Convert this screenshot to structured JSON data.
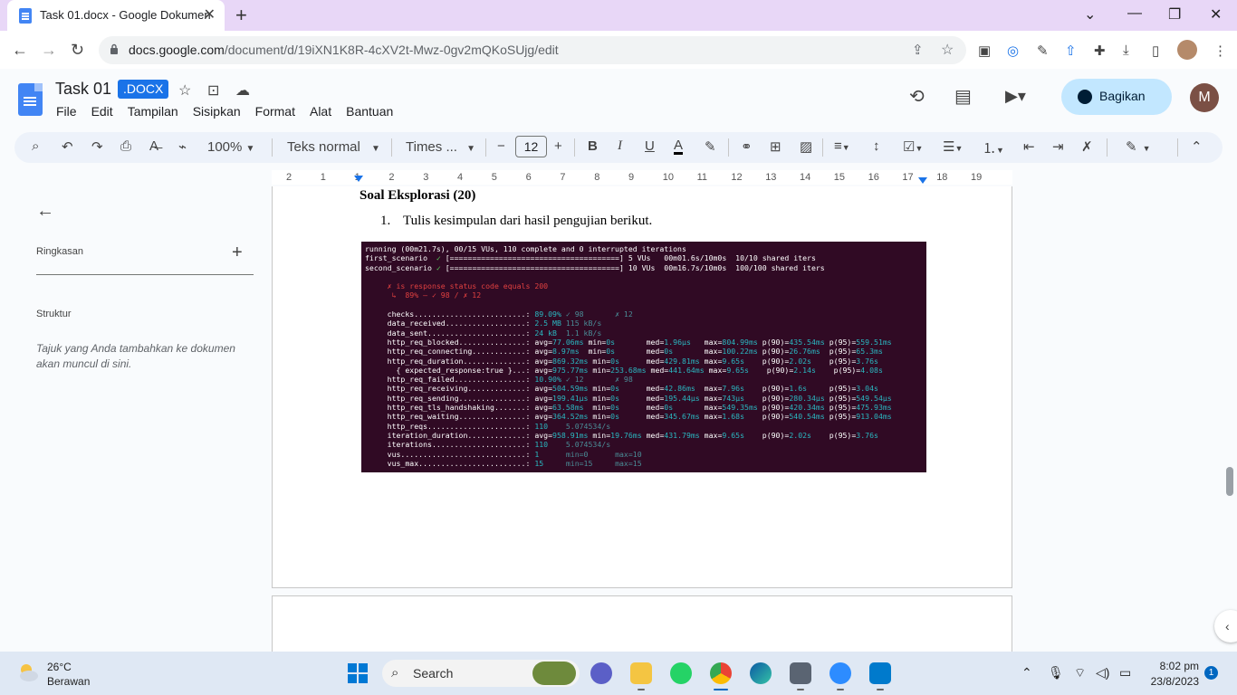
{
  "browser": {
    "tab_title": "Task 01.docx - Google Dokumen",
    "url_host": "docs.google.com",
    "url_path": "/document/d/19iXN1K8R-4cXV2t-Mwz-0gv2mQKoSUjg/edit"
  },
  "docs": {
    "title": "Task 01",
    "badge": ".DOCX",
    "menu": [
      "File",
      "Edit",
      "Tampilan",
      "Sisipkan",
      "Format",
      "Alat",
      "Bantuan"
    ],
    "share_label": "Bagikan",
    "avatar_letter": "M"
  },
  "toolbar": {
    "zoom": "100%",
    "style": "Teks normal",
    "font": "Times ...",
    "font_size": "12"
  },
  "ruler": [
    "2",
    "1",
    "1",
    "2",
    "3",
    "4",
    "5",
    "6",
    "7",
    "8",
    "9",
    "10",
    "11",
    "12",
    "13",
    "14",
    "15",
    "16",
    "17",
    "18",
    "19"
  ],
  "sidebar": {
    "summary_label": "Ringkasan",
    "structure_label": "Struktur",
    "hint": "Tajuk yang Anda tambahkan ke dokumen akan muncul di sini."
  },
  "document": {
    "heading": "Soal Eksplorasi (20)",
    "list_number": "1.",
    "list_text": "Tulis kesimpulan dari hasil pengujian berikut."
  },
  "terminal": {
    "lines": [
      [
        {
          "t": "running (00m21.7s), 00/15 VUs, 110 complete and 0 interrupted iterations",
          "c": ""
        }
      ],
      [
        {
          "t": "first_scenario  ",
          "c": ""
        },
        {
          "t": "✓",
          "c": "g"
        },
        {
          "t": " [======================================] 5 VUs   00m01.6s/10m0s  10/10 shared iters",
          "c": ""
        }
      ],
      [
        {
          "t": "second_scenario ",
          "c": ""
        },
        {
          "t": "✓",
          "c": "g"
        },
        {
          "t": " [======================================] 10 VUs  00m16.7s/10m0s  100/100 shared iters",
          "c": ""
        }
      ],
      [
        {
          "t": " ",
          "c": ""
        }
      ],
      [
        {
          "t": "     ✗ is response status code equals 200",
          "c": "r"
        }
      ],
      [
        {
          "t": "      ↳  89% — ✓ 98 / ✗ 12",
          "c": "r"
        }
      ],
      [
        {
          "t": " ",
          "c": ""
        }
      ],
      [
        {
          "t": "     checks.........................: ",
          "c": ""
        },
        {
          "t": "89.09% ",
          "c": "c"
        },
        {
          "t": "✓ 98       ",
          "c": "d"
        },
        {
          "t": "✗ 12",
          "c": "d"
        }
      ],
      [
        {
          "t": "     data_received..................: ",
          "c": ""
        },
        {
          "t": "2.5 MB ",
          "c": "c"
        },
        {
          "t": "115 kB/s",
          "c": "d"
        }
      ],
      [
        {
          "t": "     data_sent......................: ",
          "c": ""
        },
        {
          "t": "24 kB  ",
          "c": "c"
        },
        {
          "t": "1.1 kB/s",
          "c": "d"
        }
      ],
      [
        {
          "t": "     http_req_blocked...............: ",
          "c": ""
        },
        {
          "t": "avg=",
          "c": ""
        },
        {
          "t": "77.06ms ",
          "c": "c"
        },
        {
          "t": "min=",
          "c": ""
        },
        {
          "t": "0s       ",
          "c": "c"
        },
        {
          "t": "med=",
          "c": ""
        },
        {
          "t": "1.96µs   ",
          "c": "c"
        },
        {
          "t": "max=",
          "c": ""
        },
        {
          "t": "804.99ms ",
          "c": "c"
        },
        {
          "t": "p(90)=",
          "c": ""
        },
        {
          "t": "435.54ms ",
          "c": "c"
        },
        {
          "t": "p(95)=",
          "c": ""
        },
        {
          "t": "559.51ms",
          "c": "c"
        }
      ],
      [
        {
          "t": "     http_req_connecting............: ",
          "c": ""
        },
        {
          "t": "avg=",
          "c": ""
        },
        {
          "t": "8.97ms  ",
          "c": "c"
        },
        {
          "t": "min=",
          "c": ""
        },
        {
          "t": "0s       ",
          "c": "c"
        },
        {
          "t": "med=",
          "c": ""
        },
        {
          "t": "0s       ",
          "c": "c"
        },
        {
          "t": "max=",
          "c": ""
        },
        {
          "t": "100.22ms ",
          "c": "c"
        },
        {
          "t": "p(90)=",
          "c": ""
        },
        {
          "t": "26.76ms  ",
          "c": "c"
        },
        {
          "t": "p(95)=",
          "c": ""
        },
        {
          "t": "65.3ms",
          "c": "c"
        }
      ],
      [
        {
          "t": "     http_req_duration..............: ",
          "c": ""
        },
        {
          "t": "avg=",
          "c": ""
        },
        {
          "t": "869.32ms ",
          "c": "c"
        },
        {
          "t": "min=",
          "c": ""
        },
        {
          "t": "0s      ",
          "c": "c"
        },
        {
          "t": "med=",
          "c": ""
        },
        {
          "t": "429.81ms ",
          "c": "c"
        },
        {
          "t": "max=",
          "c": ""
        },
        {
          "t": "9.65s    ",
          "c": "c"
        },
        {
          "t": "p(90)=",
          "c": ""
        },
        {
          "t": "2.02s    ",
          "c": "c"
        },
        {
          "t": "p(95)=",
          "c": ""
        },
        {
          "t": "3.76s",
          "c": "c"
        }
      ],
      [
        {
          "t": "       { expected_response:true }...: ",
          "c": ""
        },
        {
          "t": "avg=",
          "c": ""
        },
        {
          "t": "975.77ms ",
          "c": "c"
        },
        {
          "t": "min=",
          "c": ""
        },
        {
          "t": "253.68ms ",
          "c": "c"
        },
        {
          "t": "med=",
          "c": ""
        },
        {
          "t": "441.64ms ",
          "c": "c"
        },
        {
          "t": "max=",
          "c": ""
        },
        {
          "t": "9.65s    ",
          "c": "c"
        },
        {
          "t": "p(90)=",
          "c": ""
        },
        {
          "t": "2.14s    ",
          "c": "c"
        },
        {
          "t": "p(95)=",
          "c": ""
        },
        {
          "t": "4.08s",
          "c": "c"
        }
      ],
      [
        {
          "t": "     http_req_failed................: ",
          "c": ""
        },
        {
          "t": "10.90% ",
          "c": "c"
        },
        {
          "t": "✓ 12       ",
          "c": "d"
        },
        {
          "t": "✗ 98",
          "c": "d"
        }
      ],
      [
        {
          "t": "     http_req_receiving.............: ",
          "c": ""
        },
        {
          "t": "avg=",
          "c": ""
        },
        {
          "t": "504.59ms ",
          "c": "c"
        },
        {
          "t": "min=",
          "c": ""
        },
        {
          "t": "0s      ",
          "c": "c"
        },
        {
          "t": "med=",
          "c": ""
        },
        {
          "t": "42.86ms  ",
          "c": "c"
        },
        {
          "t": "max=",
          "c": ""
        },
        {
          "t": "7.96s    ",
          "c": "c"
        },
        {
          "t": "p(90)=",
          "c": ""
        },
        {
          "t": "1.6s     ",
          "c": "c"
        },
        {
          "t": "p(95)=",
          "c": ""
        },
        {
          "t": "3.04s",
          "c": "c"
        }
      ],
      [
        {
          "t": "     http_req_sending...............: ",
          "c": ""
        },
        {
          "t": "avg=",
          "c": ""
        },
        {
          "t": "199.41µs ",
          "c": "c"
        },
        {
          "t": "min=",
          "c": ""
        },
        {
          "t": "0s      ",
          "c": "c"
        },
        {
          "t": "med=",
          "c": ""
        },
        {
          "t": "195.44µs ",
          "c": "c"
        },
        {
          "t": "max=",
          "c": ""
        },
        {
          "t": "743µs    ",
          "c": "c"
        },
        {
          "t": "p(90)=",
          "c": ""
        },
        {
          "t": "280.34µs ",
          "c": "c"
        },
        {
          "t": "p(95)=",
          "c": ""
        },
        {
          "t": "549.54µs",
          "c": "c"
        }
      ],
      [
        {
          "t": "     http_req_tls_handshaking.......: ",
          "c": ""
        },
        {
          "t": "avg=",
          "c": ""
        },
        {
          "t": "63.58ms  ",
          "c": "c"
        },
        {
          "t": "min=",
          "c": ""
        },
        {
          "t": "0s      ",
          "c": "c"
        },
        {
          "t": "med=",
          "c": ""
        },
        {
          "t": "0s       ",
          "c": "c"
        },
        {
          "t": "max=",
          "c": ""
        },
        {
          "t": "549.35ms ",
          "c": "c"
        },
        {
          "t": "p(90)=",
          "c": ""
        },
        {
          "t": "420.34ms ",
          "c": "c"
        },
        {
          "t": "p(95)=",
          "c": ""
        },
        {
          "t": "475.93ms",
          "c": "c"
        }
      ],
      [
        {
          "t": "     http_req_waiting...............: ",
          "c": ""
        },
        {
          "t": "avg=",
          "c": ""
        },
        {
          "t": "364.52ms ",
          "c": "c"
        },
        {
          "t": "min=",
          "c": ""
        },
        {
          "t": "0s      ",
          "c": "c"
        },
        {
          "t": "med=",
          "c": ""
        },
        {
          "t": "345.67ms ",
          "c": "c"
        },
        {
          "t": "max=",
          "c": ""
        },
        {
          "t": "1.68s    ",
          "c": "c"
        },
        {
          "t": "p(90)=",
          "c": ""
        },
        {
          "t": "540.54ms ",
          "c": "c"
        },
        {
          "t": "p(95)=",
          "c": ""
        },
        {
          "t": "913.04ms",
          "c": "c"
        }
      ],
      [
        {
          "t": "     http_reqs......................: ",
          "c": ""
        },
        {
          "t": "110    ",
          "c": "c"
        },
        {
          "t": "5.074534/s",
          "c": "d"
        }
      ],
      [
        {
          "t": "     iteration_duration.............: ",
          "c": ""
        },
        {
          "t": "avg=",
          "c": ""
        },
        {
          "t": "958.91ms ",
          "c": "c"
        },
        {
          "t": "min=",
          "c": ""
        },
        {
          "t": "19.76ms ",
          "c": "c"
        },
        {
          "t": "med=",
          "c": ""
        },
        {
          "t": "431.79ms ",
          "c": "c"
        },
        {
          "t": "max=",
          "c": ""
        },
        {
          "t": "9.65s    ",
          "c": "c"
        },
        {
          "t": "p(90)=",
          "c": ""
        },
        {
          "t": "2.02s    ",
          "c": "c"
        },
        {
          "t": "p(95)=",
          "c": ""
        },
        {
          "t": "3.76s",
          "c": "c"
        }
      ],
      [
        {
          "t": "     iterations.....................: ",
          "c": ""
        },
        {
          "t": "110    ",
          "c": "c"
        },
        {
          "t": "5.074534/s",
          "c": "d"
        }
      ],
      [
        {
          "t": "     vus............................: ",
          "c": ""
        },
        {
          "t": "1      ",
          "c": "c"
        },
        {
          "t": "min=0      max=10",
          "c": "d"
        }
      ],
      [
        {
          "t": "     vus_max........................: ",
          "c": ""
        },
        {
          "t": "15     ",
          "c": "c"
        },
        {
          "t": "min=15     max=15",
          "c": "d"
        }
      ]
    ]
  },
  "taskbar": {
    "temperature": "26°C",
    "weather": "Berawan",
    "search_label": "Search",
    "time": "8:02 pm",
    "date": "23/8/2023",
    "notification_count": "1"
  }
}
